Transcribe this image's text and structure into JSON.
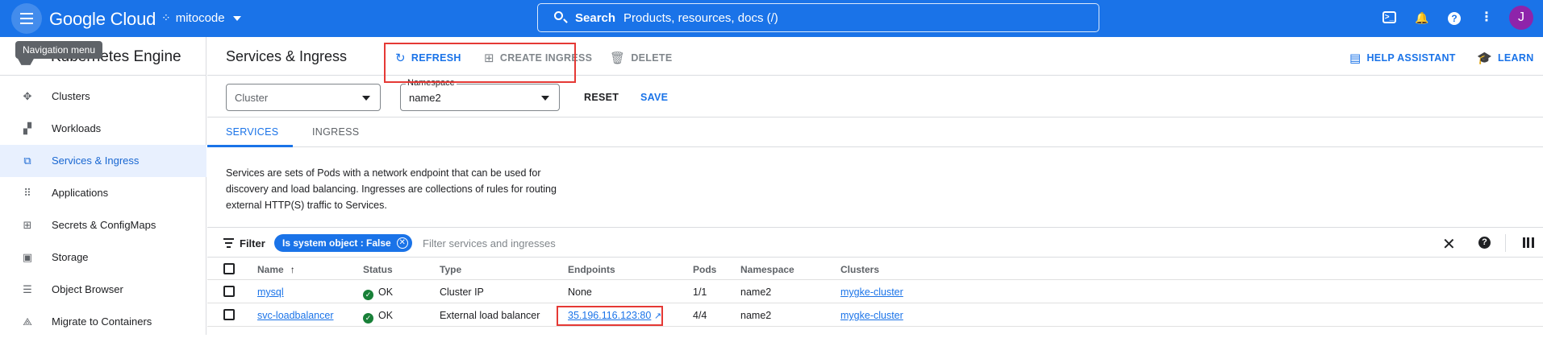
{
  "topbar": {
    "logo": "Google Cloud",
    "project": "mitocode",
    "search_bold": "Search",
    "search_text": "Products, resources, docs (/)",
    "avatar": "J"
  },
  "tooltip": "Navigation menu",
  "sidebar": {
    "product": "Kubernetes Engine",
    "items": [
      {
        "label": "Clusters",
        "icon": "clusters-icon"
      },
      {
        "label": "Workloads",
        "icon": "workloads-icon"
      },
      {
        "label": "Services & Ingress",
        "icon": "services-icon",
        "active": true
      },
      {
        "label": "Applications",
        "icon": "applications-icon"
      },
      {
        "label": "Secrets & ConfigMaps",
        "icon": "secrets-icon"
      },
      {
        "label": "Storage",
        "icon": "storage-icon"
      },
      {
        "label": "Object Browser",
        "icon": "object-browser-icon"
      },
      {
        "label": "Migrate to Containers",
        "icon": "migrate-icon"
      }
    ]
  },
  "toolbar": {
    "title": "Services & Ingress",
    "refresh": "REFRESH",
    "create": "CREATE INGRESS",
    "delete": "DELETE",
    "help": "HELP ASSISTANT",
    "learn": "LEARN"
  },
  "filters": {
    "cluster_placeholder": "Cluster",
    "namespace_label": "Namespace",
    "namespace_value": "name2",
    "reset": "RESET",
    "save": "SAVE"
  },
  "tabs": [
    "SERVICES",
    "INGRESS"
  ],
  "description": "Services are sets of Pods with a network endpoint that can be used for discovery and load balancing. Ingresses are collections of rules for routing external HTTP(S) traffic to Services.",
  "filterbar": {
    "label": "Filter",
    "chip": "Is system object : False",
    "placeholder": "Filter services and ingresses"
  },
  "table": {
    "columns": [
      "Name",
      "Status",
      "Type",
      "Endpoints",
      "Pods",
      "Namespace",
      "Clusters"
    ],
    "rows": [
      {
        "name": "mysql",
        "status": "OK",
        "type": "Cluster IP",
        "endpoints": "None",
        "pods": "1/1",
        "namespace": "name2",
        "cluster": "mygke-cluster"
      },
      {
        "name": "svc-loadbalancer",
        "status": "OK",
        "type": "External load balancer",
        "endpoints": "35.196.116.123:80",
        "pods": "4/4",
        "namespace": "name2",
        "cluster": "mygke-cluster"
      }
    ]
  },
  "colors": {
    "brand": "#1a73e8",
    "highlight": "#e53935",
    "ok": "#188038"
  }
}
